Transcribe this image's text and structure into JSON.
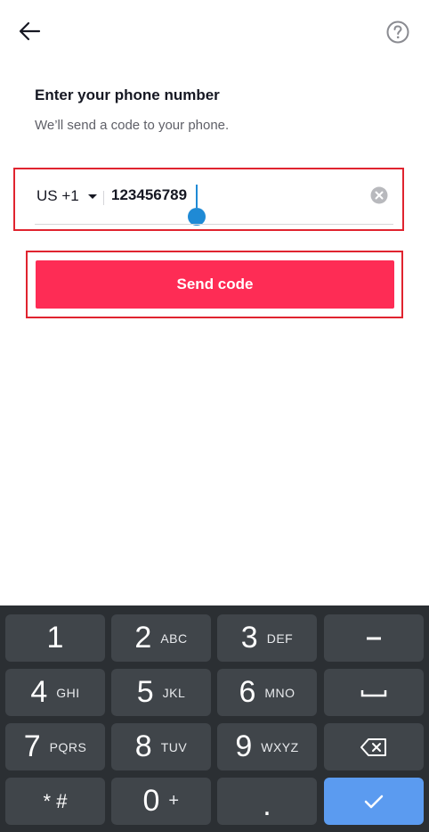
{
  "header": {
    "back_icon": "arrow-left-icon",
    "help_icon": "question-circle-icon"
  },
  "title": "Enter your phone number",
  "subtitle": "We’ll send a code to your phone.",
  "phone": {
    "country_code": "US +1",
    "value": "123456789",
    "clear_icon": "clear-circle-icon"
  },
  "send_button": {
    "label": "Send code",
    "color": "#fe2c55"
  },
  "highlight_color": "#e0242f",
  "keyboard": {
    "keys": [
      {
        "num": "1",
        "letters": ""
      },
      {
        "num": "2",
        "letters": "ABC"
      },
      {
        "num": "3",
        "letters": "DEF"
      },
      {
        "num": "4",
        "letters": "GHI"
      },
      {
        "num": "5",
        "letters": "JKL"
      },
      {
        "num": "6",
        "letters": "MNO"
      },
      {
        "num": "7",
        "letters": "PQRS"
      },
      {
        "num": "8",
        "letters": "TUV"
      },
      {
        "num": "9",
        "letters": "WXYZ"
      },
      {
        "num": "0",
        "letters": "+"
      }
    ],
    "star_hash": "* #",
    "dot": ".",
    "minus_icon": "minus-icon",
    "space_icon": "space-bar-icon",
    "backspace_icon": "backspace-icon",
    "enter_icon": "check-icon"
  }
}
